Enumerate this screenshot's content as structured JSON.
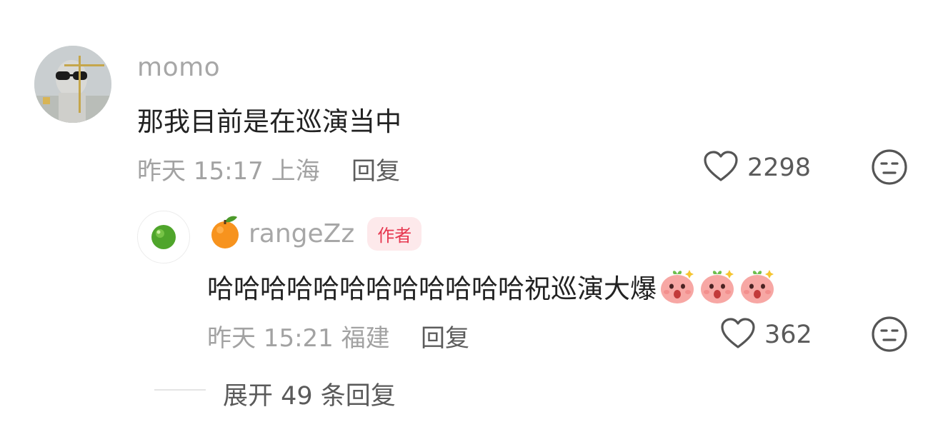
{
  "comment": {
    "username": "momo",
    "text": "那我目前是在巡演当中",
    "meta": "昨天 15:17 上海",
    "reply_label": "回复",
    "like_count": "2298"
  },
  "reply": {
    "username_emoji": "🍊",
    "username": "rangeZz",
    "author_badge": "作者",
    "text": "哈哈哈哈哈哈哈哈哈哈哈哈祝巡演大爆",
    "meta": "昨天 15:21 福建",
    "reply_label": "回复",
    "like_count": "362"
  },
  "expand": {
    "label": "展开 49 条回复"
  },
  "colors": {
    "badge_bg": "#fde9eb",
    "badge_text": "#e6374f",
    "secondary_text": "#a2a2a2"
  }
}
